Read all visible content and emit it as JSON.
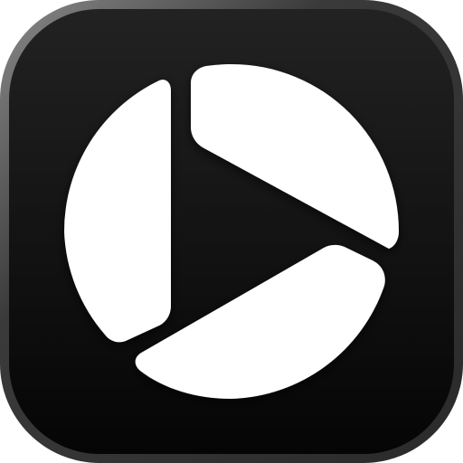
{
  "icon": {
    "name": "play-button-pie-icon",
    "colors": {
      "bezel_highlight": "#8a8a8a",
      "bezel_dark": "#2a2a2a",
      "face_top": "#222222",
      "face_bottom": "#050505",
      "glyph": "#ffffff"
    }
  }
}
